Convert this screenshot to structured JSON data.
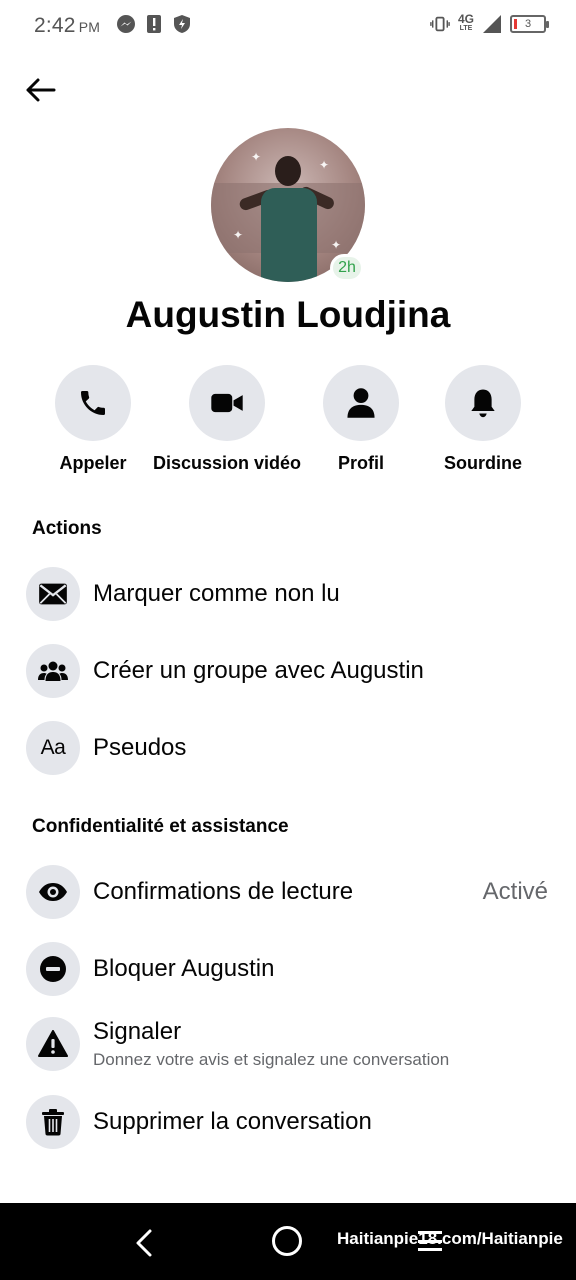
{
  "status_bar": {
    "time": "2:42",
    "ampm": "PM",
    "network": "4G",
    "network_sub": "LTE",
    "battery": "3",
    "battery_color": "#e53935"
  },
  "header": {
    "back_icon": "arrow-left-icon"
  },
  "profile": {
    "name": "Augustin Loudjina",
    "presence": "2h",
    "presence_color": "#31a24c"
  },
  "quick_actions": [
    {
      "label": "Appeler",
      "icon": "phone-icon"
    },
    {
      "label": "Discussion vidéo",
      "icon": "video-camera-icon"
    },
    {
      "label": "Profil",
      "icon": "person-icon"
    },
    {
      "label": "Sourdine",
      "icon": "bell-icon"
    }
  ],
  "actions_section": {
    "title": "Actions",
    "items": [
      {
        "label": "Marquer comme non lu",
        "icon": "envelope-icon"
      },
      {
        "label": "Créer un groupe avec Augustin",
        "icon": "group-icon"
      },
      {
        "label": "Pseudos",
        "icon": "text-aa-icon",
        "glyph": "Aa"
      }
    ]
  },
  "privacy_section": {
    "title": "Confidentialité et assistance",
    "items": [
      {
        "label": "Confirmations de lecture",
        "value": "Activé",
        "icon": "eye-icon"
      },
      {
        "label": "Bloquer Augustin",
        "icon": "block-icon"
      },
      {
        "label": "Signaler",
        "sublabel": "Donnez votre avis et signalez une conversation",
        "icon": "warning-icon"
      },
      {
        "label": "Supprimer la conversation",
        "icon": "trash-icon"
      }
    ]
  },
  "nav_bar": {
    "watermark": "Haitianpie18.com/Haitianpie"
  },
  "colors": {
    "icon_bg": "#e4e6eb",
    "text": "#050505",
    "secondary": "#65676b"
  }
}
